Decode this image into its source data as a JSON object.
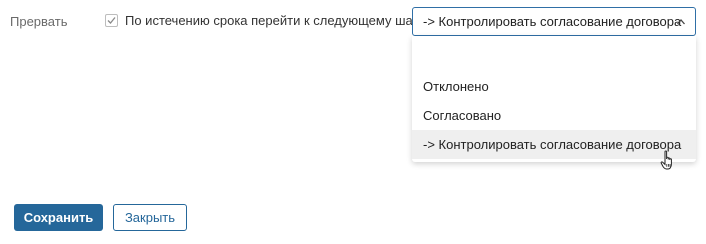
{
  "left_label": "Прервать",
  "checkbox": {
    "label": "По истечению срока перейти к следующему шагу",
    "checked": true
  },
  "select": {
    "value": "-> Контролировать согласование договора",
    "options": [
      "Отклонено",
      "Согласовано",
      "-> Контролировать согласование договора"
    ],
    "hovered_option": "-> Контролировать согласование договора"
  },
  "buttons": {
    "save_label": "Сохранить",
    "close_label": "Закрыть"
  },
  "colors": {
    "primary": "#25679a",
    "border_active": "#2f6fa6",
    "hover_bg": "#efefef"
  }
}
